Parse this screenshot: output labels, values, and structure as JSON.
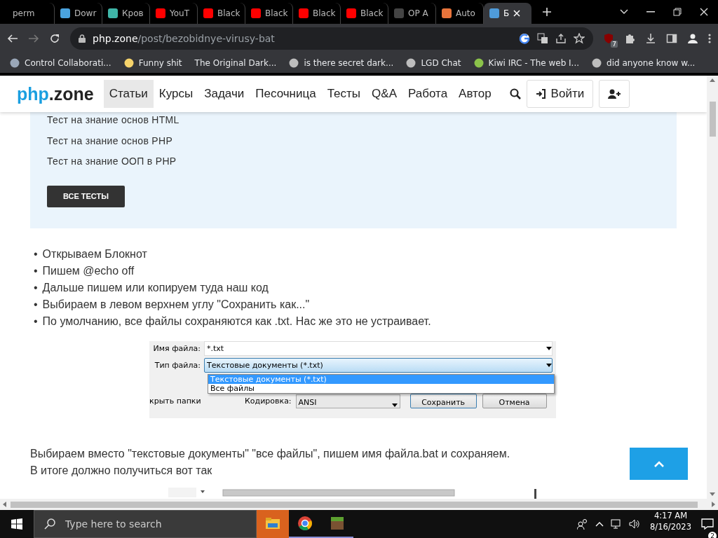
{
  "browser": {
    "tabs": [
      {
        "title": "perm",
        "selected": false
      },
      {
        "title": "Dowr",
        "selected": false,
        "color": "#4aa3df"
      },
      {
        "title": "Кров",
        "selected": false,
        "color": "#3fb6a8"
      },
      {
        "title": "YouT",
        "selected": false,
        "color": "#ff0000"
      },
      {
        "title": "Black",
        "selected": false,
        "color": "#ff0000"
      },
      {
        "title": "Black",
        "selected": false,
        "color": "#ff0000"
      },
      {
        "title": "Black",
        "selected": false,
        "color": "#ff0000"
      },
      {
        "title": "Black",
        "selected": false,
        "color": "#ff0000"
      },
      {
        "title": "OP A",
        "selected": false,
        "color": "#444444"
      },
      {
        "title": "Auto",
        "selected": false,
        "color": "#e8743b"
      },
      {
        "title": "Б",
        "selected": true,
        "color": "#4f9bd9"
      }
    ],
    "address": {
      "host": "php.zone",
      "path": "/post/bezobidnye-virusy-bat"
    },
    "extension_badge": "7",
    "bookmarks": [
      {
        "title": "Control Collaborati...",
        "color": "#9aa7b8"
      },
      {
        "title": "Funny shit",
        "color": "#f6d36b"
      },
      {
        "title": "The Original Dark..."
      },
      {
        "title": "is there secret dark...",
        "color": "#bdbdbd"
      },
      {
        "title": "LGD Chat",
        "color": "#bdbdbd"
      },
      {
        "title": "Kiwi IRC - The web I...",
        "color": "#8bc34a"
      },
      {
        "title": "did anyone know w...",
        "color": "#bdbdbd"
      }
    ]
  },
  "site": {
    "logo": {
      "accent": "php",
      "rest": ".zone"
    },
    "nav": [
      {
        "label": "Статьи",
        "selected": true
      },
      {
        "label": "Курсы",
        "selected": false
      },
      {
        "label": "Задачи",
        "selected": false
      },
      {
        "label": "Песочница",
        "selected": false
      },
      {
        "label": "Тесты",
        "selected": false
      },
      {
        "label": "Q&A",
        "selected": false
      },
      {
        "label": "Работа",
        "selected": false
      },
      {
        "label": "Автор",
        "selected": false
      }
    ],
    "login": "Войти"
  },
  "tests_box": {
    "links": [
      "Тест на знание основ HTML",
      "Тест на знание основ PHP",
      "Тест на знание ООП в PHP"
    ],
    "button": "ВСЕ ТЕСТЫ"
  },
  "steps": [
    {
      "marker": "•",
      "text": "Открываем Блокнот"
    },
    {
      "marker": "•",
      "text": "Пишем @echo off"
    },
    {
      "marker": "•",
      "text": "Дальше пишем или копируем туда наш код"
    },
    {
      "marker": "•",
      "text": "Выбираем в левом верхнем углу \"Сохранить как...\""
    },
    {
      "marker": "•",
      "text": "По умолчанию, все файлы сохраняются как .txt. Нас же это не устраивает."
    }
  ],
  "dialog": {
    "filename_label": "Имя файла:",
    "filename": "*.txt",
    "type_label": "Тип файла:",
    "type_value": "Текстовые документы (*.txt)",
    "options": [
      {
        "label": "Текстовые документы (*.txt)",
        "selected": true
      },
      {
        "label": "Все файлы",
        "selected": false
      }
    ],
    "hide_folders": "крыть папки",
    "encoding_label": "Кодировка:",
    "encoding": "ANSI",
    "save": "Сохранить",
    "cancel": "Отмена"
  },
  "paragraph": [
    "Выбираем вместо \"текстовые документы\" \"все файлы\", пишем имя файла.bat и сохраняем.",
    "В итоге должно получиться вот так"
  ],
  "taskbar": {
    "search_placeholder": "Type here to search",
    "apps": [
      {
        "attention": true,
        "running": false
      },
      {
        "attention": false,
        "running": true
      },
      {
        "attention": false,
        "running": true
      }
    ],
    "time": "4:17 AM",
    "date": "8/16/2023",
    "notifications": "2"
  }
}
